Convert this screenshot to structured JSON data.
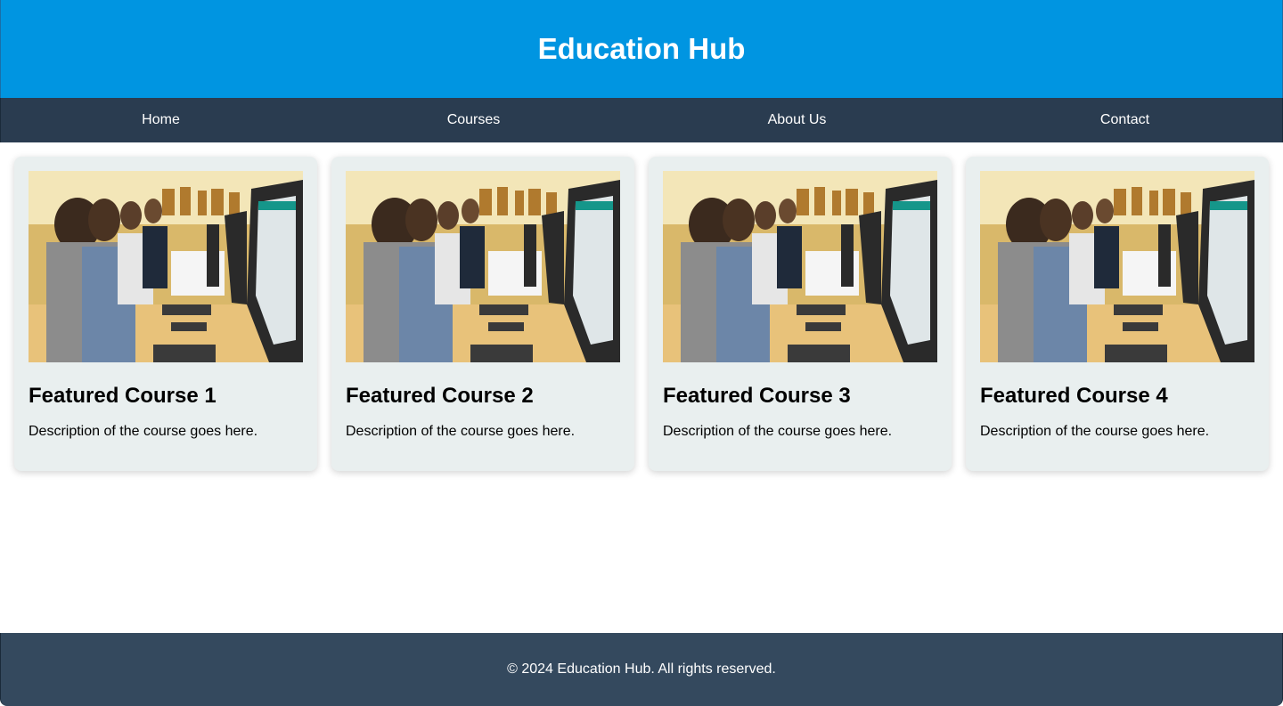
{
  "header": {
    "title": "Education Hub"
  },
  "nav": {
    "items": [
      {
        "label": "Home"
      },
      {
        "label": "Courses"
      },
      {
        "label": "About Us"
      },
      {
        "label": "Contact"
      }
    ]
  },
  "courses": [
    {
      "title": "Featured Course 1",
      "description": "Description of the course goes here."
    },
    {
      "title": "Featured Course 2",
      "description": "Description of the course goes here."
    },
    {
      "title": "Featured Course 3",
      "description": "Description of the course goes here."
    },
    {
      "title": "Featured Course 4",
      "description": "Description of the course goes here."
    }
  ],
  "footer": {
    "text": "© 2024 Education Hub. All rights reserved."
  },
  "colors": {
    "header_bg": "#0095e1",
    "nav_bg": "#2a3c50",
    "card_bg": "#e9efef",
    "footer_bg": "#34495e"
  }
}
